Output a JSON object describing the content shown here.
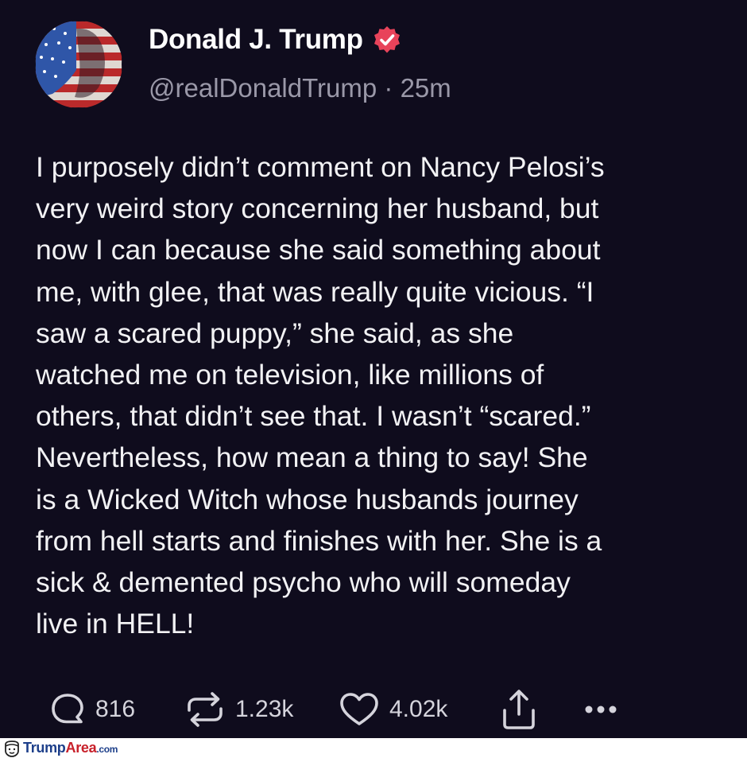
{
  "author": {
    "name": "Donald J. Trump",
    "handle": "@realDonaldTrump",
    "separator": "·",
    "time": "25m"
  },
  "post": {
    "text": "I purposely didn’t comment on Nancy Pelosi’s\nvery weird story concerning her husband, but\nnow I can because she said something about\nme, with glee, that was really quite vicious. “I\nsaw a scared puppy,” she said, as she\nwatched me on television, like millions of\nothers,  that didn’t see that. I wasn’t “scared.”\nNevertheless, how mean a thing to say! She\nis a Wicked Witch whose husbands journey\nfrom hell starts and finishes with her. She is a\nsick & demented psycho who will someday\nlive in HELL!"
  },
  "actions": {
    "replies": "816",
    "reposts": "1.23k",
    "likes": "4.02k"
  },
  "icons": {
    "verified": "verified-badge-icon",
    "reply": "reply-icon",
    "repost": "repost-icon",
    "like": "heart-icon",
    "share": "share-icon",
    "more": "more-icon"
  },
  "watermark": {
    "brand_blue": "Trump",
    "brand_red": "Area",
    "suffix": ".com"
  },
  "colors": {
    "background": "#0f0c1d",
    "verified": "#e8435a",
    "text": "#f2f2f4",
    "muted": "#9a98a8"
  }
}
